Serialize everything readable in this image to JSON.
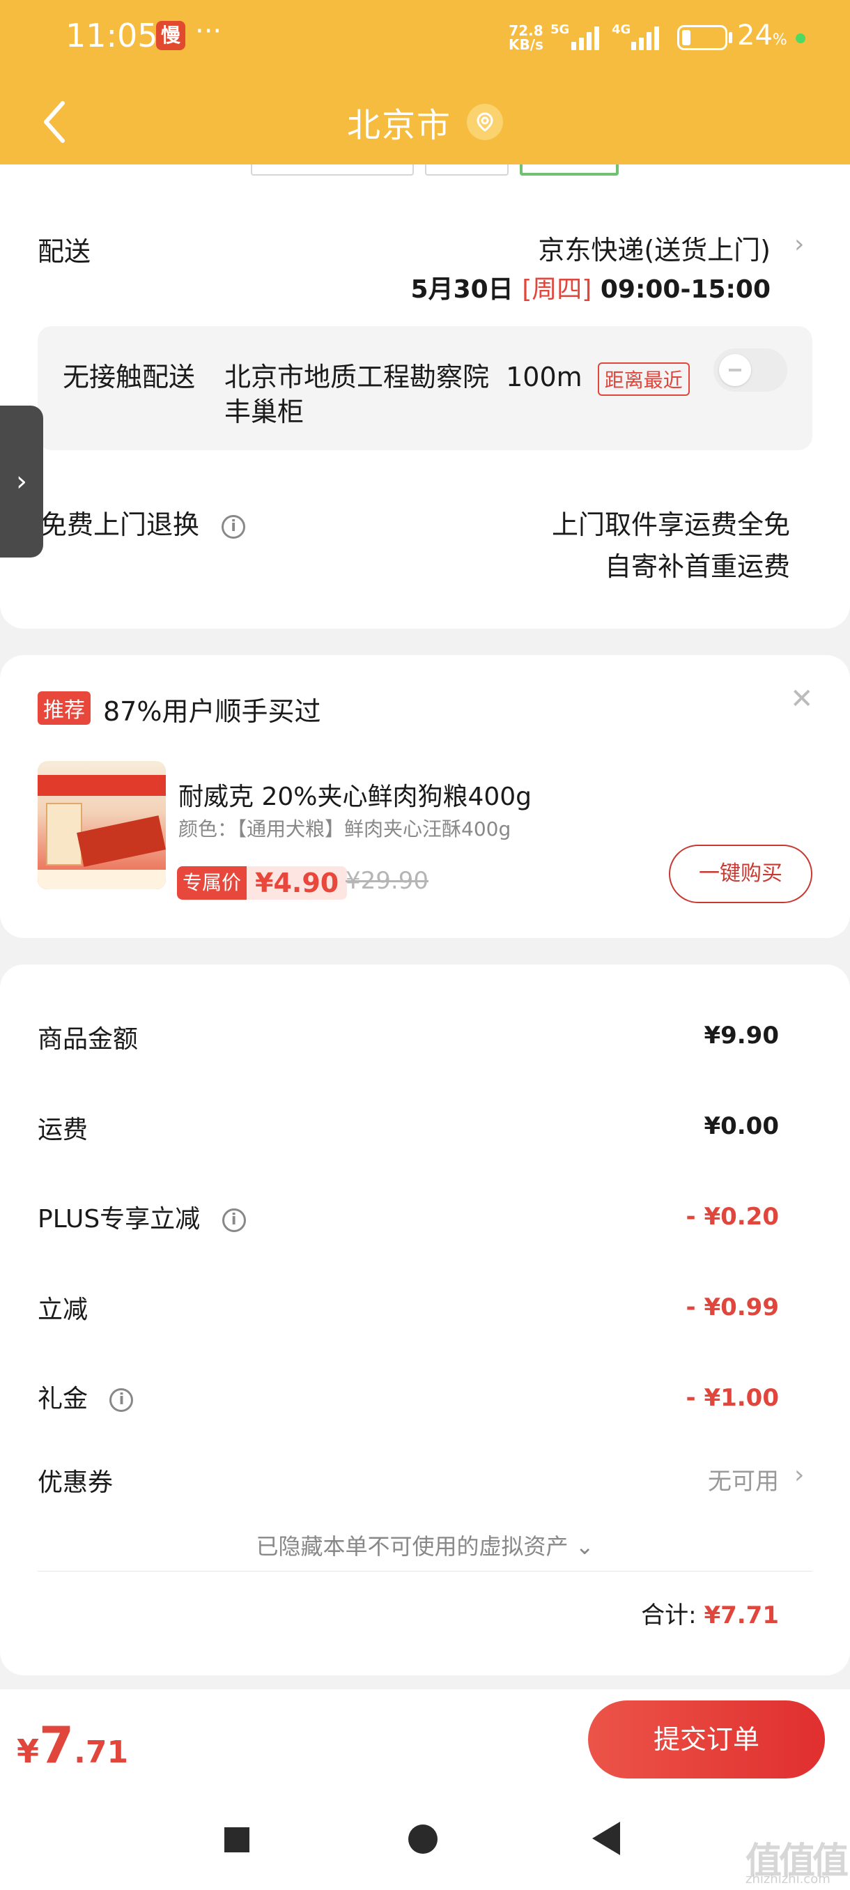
{
  "status": {
    "time": "11:05",
    "app_badge": "慢",
    "dots": "···",
    "net_speed_top": "72.8",
    "net_speed_bottom": "KB/s",
    "sig1": "5G",
    "sig2": "4G",
    "battery_pct": "24",
    "battery_unit": "%"
  },
  "header": {
    "title": "北京市"
  },
  "delivery": {
    "label": "配送",
    "carrier": "京东快递(送货上门)",
    "date": "5月30日",
    "weekday": "[周四]",
    "time_window": "09:00-15:00"
  },
  "nocontact": {
    "label": "无接触配送",
    "place_line1": "北京市地质工程勘察院",
    "distance": "100m",
    "tag": "距离最近",
    "place_line2": "丰巢柜"
  },
  "returns": {
    "label": "免费上门退换",
    "line1": "上门取件享运费全免",
    "line2": "自寄补首重运费"
  },
  "recommend": {
    "badge": "推荐",
    "text": "87%用户顺手买过",
    "product_name": "耐威克 20%夹心鲜肉狗粮400g",
    "product_spec": "颜色：【通用犬粮】鲜肉夹心汪酥400g",
    "price_label": "专属价",
    "price": "¥4.90",
    "original_price": "¥29.90",
    "buy_button": "一键购买"
  },
  "summary": {
    "goods_label": "商品金额",
    "goods_value": "¥9.90",
    "shipping_label": "运费",
    "shipping_value": "¥0.00",
    "plus_label": "PLUS专享立减",
    "plus_value": "- ¥0.20",
    "discount_label": "立减",
    "discount_value": "- ¥0.99",
    "gift_label": "礼金",
    "gift_value": "- ¥1.00",
    "coupon_label": "优惠券",
    "coupon_value": "无可用",
    "hidden_assets": "已隐藏本单不可使用的虚拟资产",
    "total_label": "合计:",
    "total_value": "¥7.71"
  },
  "footer": {
    "currency": "¥",
    "price_int": "7",
    "price_dec": ".71",
    "submit": "提交订单"
  },
  "watermark": {
    "main": "值值值",
    "sub": "zhizhizhi.com"
  },
  "colors": {
    "header": "#f5bc3f",
    "accent_red": "#e0463c"
  }
}
